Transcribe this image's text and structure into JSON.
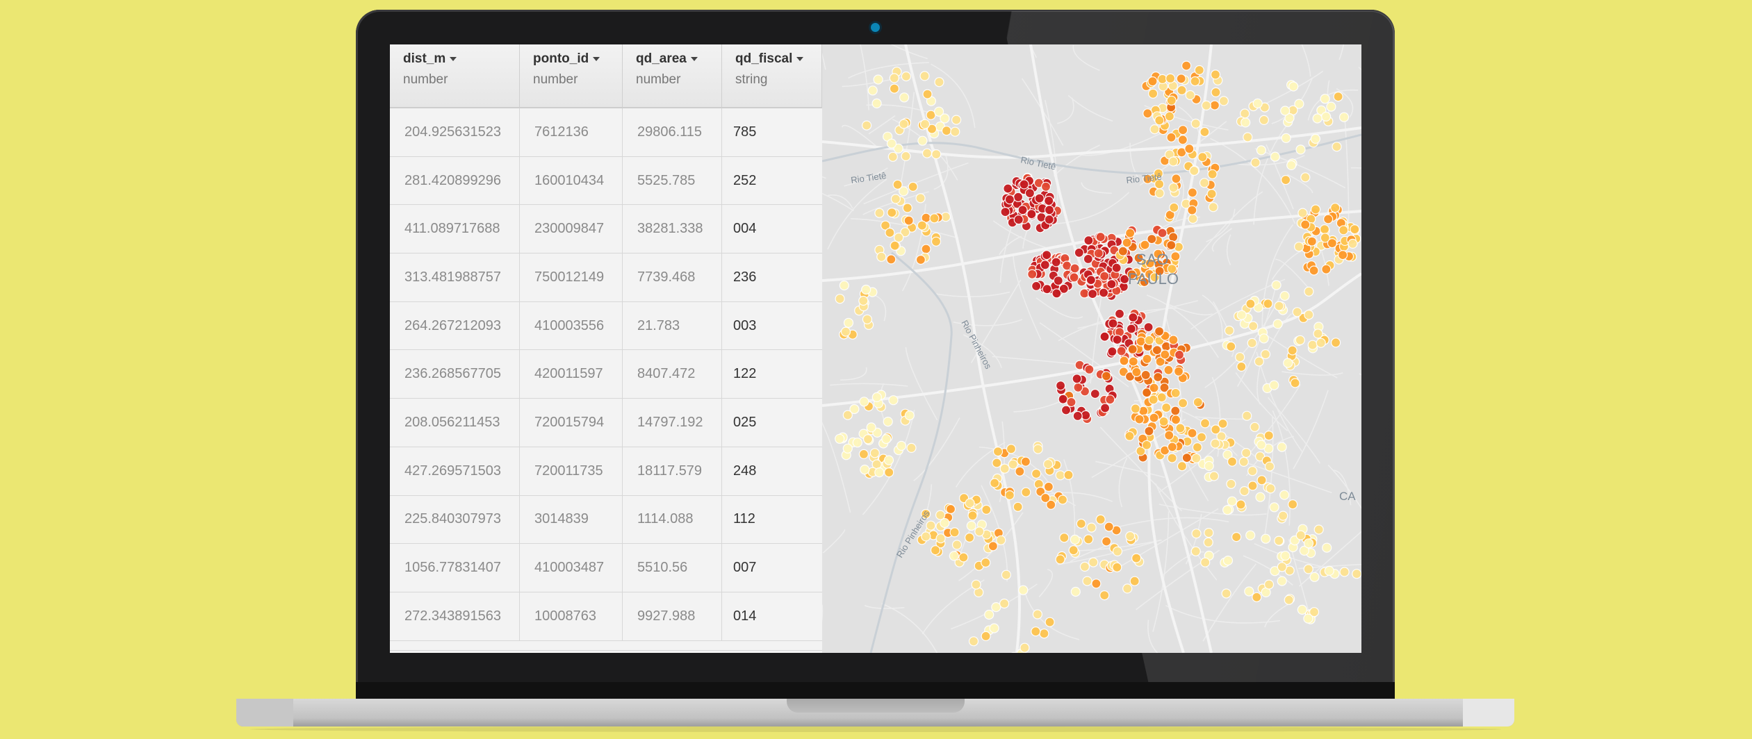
{
  "table": {
    "columns": [
      {
        "name": "dist_m",
        "type": "number"
      },
      {
        "name": "ponto_id",
        "type": "number"
      },
      {
        "name": "qd_area",
        "type": "number"
      },
      {
        "name": "qd_fiscal",
        "type": "string"
      }
    ],
    "rows": [
      [
        "204.925631523",
        "7612136",
        "29806.115",
        "785"
      ],
      [
        "281.420899296",
        "160010434",
        "5525.785",
        "252"
      ],
      [
        "411.089717688",
        "230009847",
        "38281.338",
        "004"
      ],
      [
        "313.481988757",
        "750012149",
        "7739.468",
        "236"
      ],
      [
        "264.267212093",
        "410003556",
        "21.783",
        "003"
      ],
      [
        "236.268567705",
        "420011597",
        "8407.472",
        "122"
      ],
      [
        "208.056211453",
        "720015794",
        "14797.192",
        "025"
      ],
      [
        "427.269571503",
        "720011735",
        "18117.579",
        "248"
      ],
      [
        "225.840307973",
        "3014839",
        "1114.088",
        "112"
      ],
      [
        "1056.77831407",
        "410003487",
        "5510.56",
        "007"
      ],
      [
        "272.343891563",
        "10008763",
        "9927.988",
        "014"
      ]
    ]
  },
  "map": {
    "city_label_1": "SAO",
    "city_label_2": "PAULO",
    "edge_label": "CA",
    "river_labels": [
      "Rio Tietê",
      "Rio Tietê",
      "Rio Tietê",
      "Rio Pinheiros",
      "Rio Pinheiros"
    ],
    "point_colors": [
      "#fff7bc",
      "#fee391",
      "#fec44f",
      "#fe9929",
      "#ec7014",
      "#e34a33",
      "#c51b20"
    ]
  },
  "colors": {
    "background": "#ebe772",
    "bezel": "#1b1b1c",
    "camera": "#0b86b6"
  }
}
